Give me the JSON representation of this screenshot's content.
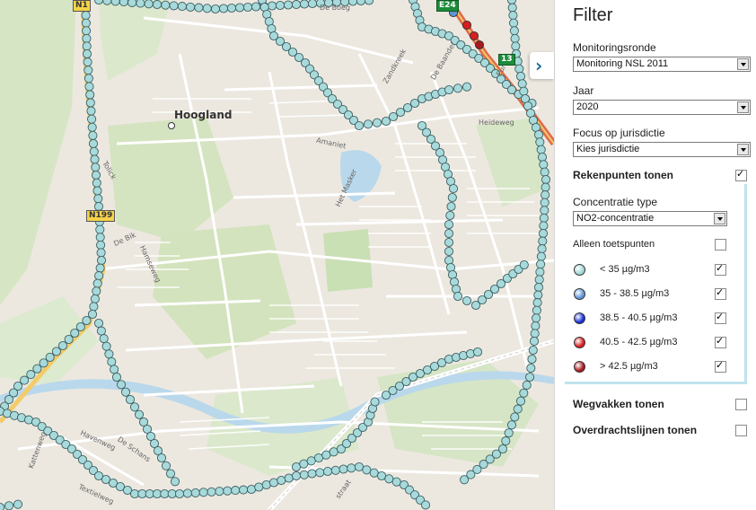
{
  "map": {
    "place_label": "Hoogland",
    "street_labels": {
      "de_boeg": "De Boeg",
      "zandkreek": "Zandkreek",
      "de_baander": "De Baander",
      "euro": "Euro",
      "heideweg": "Heideweg",
      "amaniet": "Amaniet",
      "het_masker": "Het Masker",
      "de_bik": "De Bik",
      "hamseweg": "Hamseweg",
      "havenweg": "Havenweg",
      "de_schans": "De Schans",
      "kattenweg": "Kattenweg",
      "textielweg": "Textielweg",
      "tolick": "Tolick",
      "straat": "straat"
    },
    "shields": {
      "top_left": "N1",
      "n199": "N199",
      "a1": "13",
      "top_green": "E24"
    },
    "point_color": "#a8dadb"
  },
  "panel": {
    "title": "Filter",
    "collapse_icon": "chevron-right-icon",
    "monitoringsronde": {
      "label": "Monitoringsronde",
      "value": "Monitoring NSL 2011"
    },
    "jaar": {
      "label": "Jaar",
      "value": "2020"
    },
    "jurisdictie": {
      "label": "Focus op jurisdictie",
      "value": "Kies jurisdictie"
    },
    "rekenpunten": {
      "label": "Rekenpunten tonen",
      "checked": true,
      "concentratie_label": "Concentratie type",
      "concentratie_value": "NO2-concentratie",
      "toetspunten_label": "Alleen toetspunten",
      "toetspunten_checked": false,
      "legend": [
        {
          "label": "< 35 µg/m3",
          "color": "#9fd6d6",
          "checked": true
        },
        {
          "label": "35 - 38.5 µg/m3",
          "color": "#5f95d6",
          "checked": true
        },
        {
          "label": "38.5 - 40.5 µg/m3",
          "color": "#1a2fd8",
          "checked": true
        },
        {
          "label": "40.5 - 42.5 µg/m3",
          "color": "#d81d1d",
          "checked": true
        },
        {
          "label": "> 42.5 µg/m3",
          "color": "#a8191f",
          "checked": true
        }
      ]
    },
    "wegvakken": {
      "label": "Wegvakken tonen",
      "checked": false
    },
    "overdrachtslijnen": {
      "label": "Overdrachtslijnen tonen",
      "checked": false
    }
  }
}
